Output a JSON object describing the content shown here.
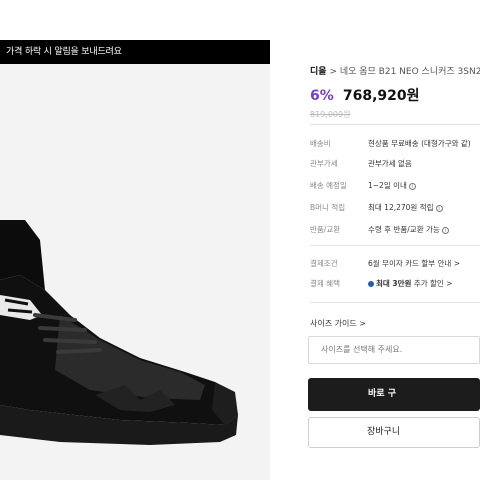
{
  "banner": {
    "text": "가격 하락 시 알림을 보내드려요"
  },
  "product": {
    "brand": "디올",
    "title": "네오 옴므 B21 NEO 스니커즈 3SN2",
    "discount": "6%",
    "price": "768,920원",
    "original_price": "819,000원"
  },
  "specs": [
    {
      "label": "배송비",
      "value": "현상품 무료배송 (대형가구와 같)"
    },
    {
      "label": "관부가세",
      "value": "관부가세 없음"
    },
    {
      "label": "배송 예정일",
      "value": "1~2일 이내"
    },
    {
      "label": "B머니 적립",
      "value": "최대 12,270원 적립"
    },
    {
      "label": "반품/교환",
      "value": "수령 후 반품/교환 가능"
    }
  ],
  "payment": [
    {
      "label": "결제조건",
      "value": "6월 무이자 카드 할부 안내 >"
    },
    {
      "label": "결제 혜택",
      "value_bold": "최대 3만원",
      "value_rest": " 추가 할인 >"
    }
  ],
  "size_guide": "사이즈 가이드 >",
  "size_select_placeholder": "사이즈를 선택해 주세요.",
  "buy_button": "바로 구",
  "cart_button": "장바구니",
  "colors": {
    "discount": "#7a3fc8",
    "button_dark": "#1c1c1c"
  }
}
